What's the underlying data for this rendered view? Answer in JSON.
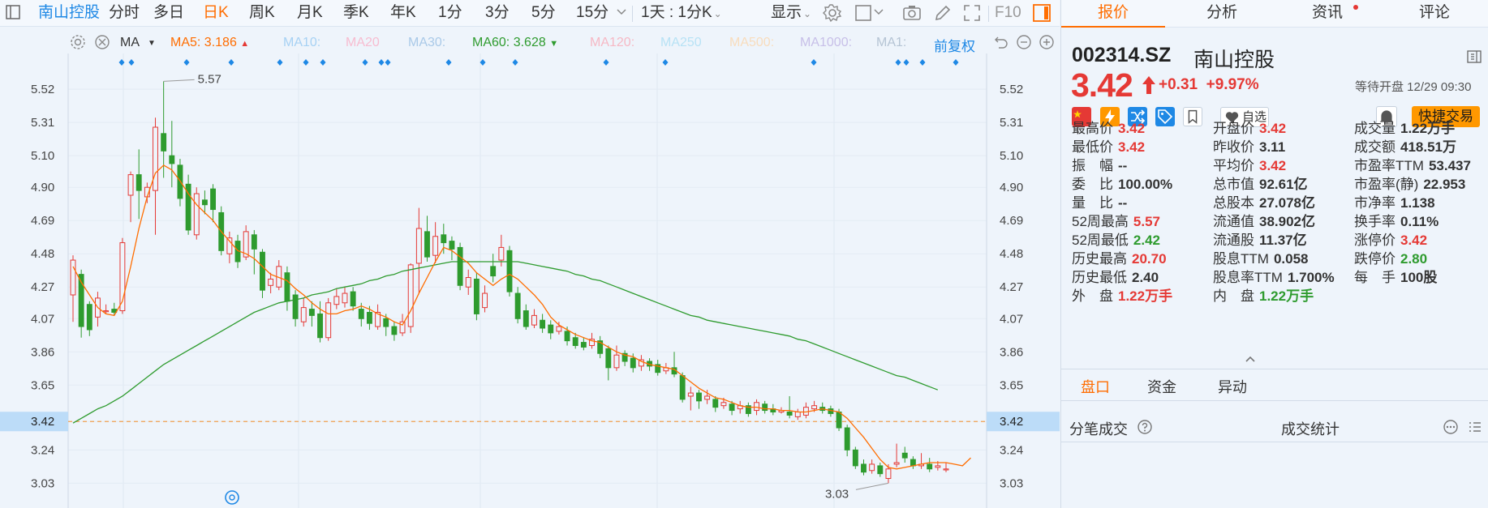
{
  "toolbar": {
    "stock_name": "南山控股",
    "periods": [
      "分时",
      "多日",
      "日K",
      "周K",
      "月K",
      "季K",
      "年K",
      "1分",
      "3分",
      "5分",
      "15分"
    ],
    "active_period": "日K",
    "multi_period": "1天 : 1分K",
    "display_label": "显示",
    "f10_label": "F10"
  },
  "ma_bar": {
    "label": "MA",
    "items": [
      {
        "label": "MA5:",
        "value": "3.186",
        "color": "#ff6d00",
        "trend": "up"
      },
      {
        "label": "MA10:",
        "value": "",
        "color": "#a6d1f4"
      },
      {
        "label": "MA20",
        "value": "",
        "color": "#f7bcd0"
      },
      {
        "label": "MA30:",
        "value": "",
        "color": "#a9c9e8"
      },
      {
        "label": "MA60:",
        "value": "3.628",
        "color": "#2e9b2e",
        "trend": "down"
      },
      {
        "label": "MA120:",
        "value": "",
        "color": "#f6b8c4"
      },
      {
        "label": "MA250",
        "value": "",
        "color": "#b7e2f5"
      },
      {
        "label": "MA500:",
        "value": "",
        "color": "#f8dcbc"
      },
      {
        "label": "MA1000:",
        "value": "",
        "color": "#c7bfe8"
      },
      {
        "label": "MA1:",
        "value": "",
        "color": "#b5c4d4"
      }
    ],
    "restore_label": "前复权"
  },
  "chart_data": {
    "type": "candlestick",
    "y_ticks": [
      "5.52",
      "5.31",
      "5.10",
      "4.90",
      "4.69",
      "4.48",
      "4.27",
      "4.07",
      "3.86",
      "3.65",
      "3.42",
      "3.24",
      "3.03"
    ],
    "current_price_label": "3.42",
    "high_annotation": "5.57",
    "low_annotation": "3.03",
    "ylim": [
      2.95,
      5.65
    ],
    "candles": [
      {
        "o": 4.22,
        "c": 4.44,
        "h": 4.47,
        "l": 4.05
      },
      {
        "o": 4.35,
        "c": 4.02,
        "h": 4.38,
        "l": 3.95
      },
      {
        "o": 4.16,
        "c": 4.0,
        "h": 4.18,
        "l": 3.96
      },
      {
        "o": 4.08,
        "c": 4.2,
        "h": 4.24,
        "l": 4.02
      },
      {
        "o": 4.12,
        "c": 4.12,
        "h": 4.16,
        "l": 4.1
      },
      {
        "o": 4.13,
        "c": 4.11,
        "h": 4.17,
        "l": 4.09
      },
      {
        "o": 4.12,
        "c": 4.55,
        "h": 4.58,
        "l": 4.1
      },
      {
        "o": 4.85,
        "c": 4.98,
        "h": 5.0,
        "l": 4.68
      },
      {
        "o": 4.98,
        "c": 4.88,
        "h": 5.14,
        "l": 4.7
      },
      {
        "o": 4.84,
        "c": 4.9,
        "h": 4.93,
        "l": 4.8
      },
      {
        "o": 4.88,
        "c": 5.28,
        "h": 5.34,
        "l": 4.6
      },
      {
        "o": 5.24,
        "c": 5.13,
        "h": 5.57,
        "l": 4.96
      },
      {
        "o": 5.1,
        "c": 5.05,
        "h": 5.32,
        "l": 4.9
      },
      {
        "o": 5.04,
        "c": 4.83,
        "h": 5.08,
        "l": 4.78
      },
      {
        "o": 4.92,
        "c": 4.63,
        "h": 4.98,
        "l": 4.6
      },
      {
        "o": 4.6,
        "c": 4.86,
        "h": 4.9,
        "l": 4.57
      },
      {
        "o": 4.82,
        "c": 4.79,
        "h": 4.88,
        "l": 4.73
      },
      {
        "o": 4.89,
        "c": 4.76,
        "h": 4.92,
        "l": 4.68
      },
      {
        "o": 4.74,
        "c": 4.5,
        "h": 4.78,
        "l": 4.47
      },
      {
        "o": 4.48,
        "c": 4.58,
        "h": 4.62,
        "l": 4.42
      },
      {
        "o": 4.56,
        "c": 4.43,
        "h": 4.6,
        "l": 4.39
      },
      {
        "o": 4.46,
        "c": 4.62,
        "h": 4.66,
        "l": 4.44
      },
      {
        "o": 4.6,
        "c": 4.51,
        "h": 4.63,
        "l": 4.35
      },
      {
        "o": 4.49,
        "c": 4.25,
        "h": 4.51,
        "l": 4.2
      },
      {
        "o": 4.28,
        "c": 4.32,
        "h": 4.36,
        "l": 4.23
      },
      {
        "o": 4.27,
        "c": 4.4,
        "h": 4.44,
        "l": 4.25
      },
      {
        "o": 4.36,
        "c": 4.18,
        "h": 4.4,
        "l": 4.12
      },
      {
        "o": 4.22,
        "c": 4.07,
        "h": 4.25,
        "l": 4.02
      },
      {
        "o": 4.05,
        "c": 4.14,
        "h": 4.2,
        "l": 4.02
      },
      {
        "o": 4.13,
        "c": 4.09,
        "h": 4.18,
        "l": 4.02
      },
      {
        "o": 4.1,
        "c": 3.95,
        "h": 4.18,
        "l": 3.92
      },
      {
        "o": 3.95,
        "c": 4.17,
        "h": 4.2,
        "l": 3.93
      },
      {
        "o": 4.16,
        "c": 4.21,
        "h": 4.26,
        "l": 4.13
      },
      {
        "o": 4.17,
        "c": 4.23,
        "h": 4.27,
        "l": 4.14
      },
      {
        "o": 4.24,
        "c": 4.15,
        "h": 4.27,
        "l": 4.12
      },
      {
        "o": 4.13,
        "c": 4.07,
        "h": 4.17,
        "l": 4.02
      },
      {
        "o": 4.11,
        "c": 4.04,
        "h": 4.15,
        "l": 4.0
      },
      {
        "o": 4.02,
        "c": 4.11,
        "h": 4.16,
        "l": 4.0
      },
      {
        "o": 4.07,
        "c": 4.02,
        "h": 4.1,
        "l": 3.96
      },
      {
        "o": 4.02,
        "c": 3.97,
        "h": 4.05,
        "l": 3.93
      },
      {
        "o": 3.98,
        "c": 4.05,
        "h": 4.1,
        "l": 3.96
      },
      {
        "o": 4.02,
        "c": 4.41,
        "h": 4.42,
        "l": 3.98
      },
      {
        "o": 4.42,
        "c": 4.64,
        "h": 4.77,
        "l": 4.23
      },
      {
        "o": 4.62,
        "c": 4.46,
        "h": 4.72,
        "l": 4.43
      },
      {
        "o": 4.47,
        "c": 4.59,
        "h": 4.68,
        "l": 4.42
      },
      {
        "o": 4.6,
        "c": 4.55,
        "h": 4.67,
        "l": 4.48
      },
      {
        "o": 4.56,
        "c": 4.51,
        "h": 4.59,
        "l": 4.44
      },
      {
        "o": 4.52,
        "c": 4.28,
        "h": 4.55,
        "l": 4.25
      },
      {
        "o": 4.27,
        "c": 4.33,
        "h": 4.38,
        "l": 4.22
      },
      {
        "o": 4.32,
        "c": 4.1,
        "h": 4.36,
        "l": 4.06
      },
      {
        "o": 4.14,
        "c": 4.23,
        "h": 4.28,
        "l": 4.11
      },
      {
        "o": 4.4,
        "c": 4.34,
        "h": 4.48,
        "l": 4.3
      },
      {
        "o": 4.44,
        "c": 4.52,
        "h": 4.6,
        "l": 4.4
      },
      {
        "o": 4.5,
        "c": 4.24,
        "h": 4.53,
        "l": 4.21
      },
      {
        "o": 4.23,
        "c": 4.07,
        "h": 4.27,
        "l": 4.04
      },
      {
        "o": 4.12,
        "c": 4.02,
        "h": 4.16,
        "l": 4.0
      },
      {
        "o": 4.03,
        "c": 4.09,
        "h": 4.13,
        "l": 4.01
      },
      {
        "o": 4.06,
        "c": 4.01,
        "h": 4.1,
        "l": 3.98
      },
      {
        "o": 4.03,
        "c": 3.98,
        "h": 4.06,
        "l": 3.94
      },
      {
        "o": 3.99,
        "c": 4.02,
        "h": 4.05,
        "l": 3.97
      },
      {
        "o": 3.99,
        "c": 3.93,
        "h": 4.02,
        "l": 3.9
      },
      {
        "o": 3.95,
        "c": 3.9,
        "h": 3.98,
        "l": 3.88
      },
      {
        "o": 3.92,
        "c": 3.89,
        "h": 3.95,
        "l": 3.87
      },
      {
        "o": 3.9,
        "c": 3.94,
        "h": 3.98,
        "l": 3.88
      },
      {
        "o": 3.93,
        "c": 3.85,
        "h": 3.96,
        "l": 3.82
      },
      {
        "o": 3.88,
        "c": 3.76,
        "h": 3.9,
        "l": 3.68
      },
      {
        "o": 3.76,
        "c": 3.84,
        "h": 3.9,
        "l": 3.74
      },
      {
        "o": 3.85,
        "c": 3.8,
        "h": 3.87,
        "l": 3.77
      },
      {
        "o": 3.82,
        "c": 3.76,
        "h": 3.85,
        "l": 3.73
      },
      {
        "o": 3.77,
        "c": 3.81,
        "h": 3.84,
        "l": 3.74
      },
      {
        "o": 3.8,
        "c": 3.77,
        "h": 3.82,
        "l": 3.74
      },
      {
        "o": 3.78,
        "c": 3.73,
        "h": 3.81,
        "l": 3.71
      },
      {
        "o": 3.74,
        "c": 3.76,
        "h": 3.79,
        "l": 3.72
      },
      {
        "o": 3.76,
        "c": 3.72,
        "h": 3.86,
        "l": 3.7
      },
      {
        "o": 3.71,
        "c": 3.56,
        "h": 3.73,
        "l": 3.54
      },
      {
        "o": 3.58,
        "c": 3.6,
        "h": 3.64,
        "l": 3.49
      },
      {
        "o": 3.6,
        "c": 3.55,
        "h": 3.62,
        "l": 3.5
      },
      {
        "o": 3.56,
        "c": 3.58,
        "h": 3.62,
        "l": 3.53
      },
      {
        "o": 3.56,
        "c": 3.51,
        "h": 3.58,
        "l": 3.48
      },
      {
        "o": 3.52,
        "c": 3.54,
        "h": 3.57,
        "l": 3.5
      },
      {
        "o": 3.53,
        "c": 3.49,
        "h": 3.55,
        "l": 3.46
      },
      {
        "o": 3.5,
        "c": 3.52,
        "h": 3.55,
        "l": 3.47
      },
      {
        "o": 3.52,
        "c": 3.47,
        "h": 3.54,
        "l": 3.45
      },
      {
        "o": 3.49,
        "c": 3.54,
        "h": 3.56,
        "l": 3.46
      },
      {
        "o": 3.53,
        "c": 3.49,
        "h": 3.55,
        "l": 3.47
      },
      {
        "o": 3.5,
        "c": 3.48,
        "h": 3.53,
        "l": 3.46
      },
      {
        "o": 3.48,
        "c": 3.49,
        "h": 3.51,
        "l": 3.47
      },
      {
        "o": 3.48,
        "c": 3.46,
        "h": 3.58,
        "l": 3.44
      },
      {
        "o": 3.45,
        "c": 3.48,
        "h": 3.5,
        "l": 3.43
      },
      {
        "o": 3.46,
        "c": 3.51,
        "h": 3.54,
        "l": 3.44
      },
      {
        "o": 3.5,
        "c": 3.52,
        "h": 3.55,
        "l": 3.48
      },
      {
        "o": 3.51,
        "c": 3.49,
        "h": 3.54,
        "l": 3.47
      },
      {
        "o": 3.5,
        "c": 3.47,
        "h": 3.52,
        "l": 3.45
      },
      {
        "o": 3.48,
        "c": 3.38,
        "h": 3.5,
        "l": 3.36
      },
      {
        "o": 3.38,
        "c": 3.24,
        "h": 3.4,
        "l": 3.2
      },
      {
        "o": 3.24,
        "c": 3.14,
        "h": 3.26,
        "l": 3.12
      },
      {
        "o": 3.15,
        "c": 3.1,
        "h": 3.18,
        "l": 3.08
      },
      {
        "o": 3.11,
        "c": 3.15,
        "h": 3.18,
        "l": 3.09
      },
      {
        "o": 3.14,
        "c": 3.09,
        "h": 3.16,
        "l": 3.07
      },
      {
        "o": 3.06,
        "c": 3.12,
        "h": 3.15,
        "l": 3.03
      },
      {
        "o": 3.15,
        "c": 3.16,
        "h": 3.28,
        "l": 3.13
      },
      {
        "o": 3.22,
        "c": 3.19,
        "h": 3.26,
        "l": 3.16
      },
      {
        "o": 3.18,
        "c": 3.14,
        "h": 3.2,
        "l": 3.12
      },
      {
        "o": 3.14,
        "c": 3.15,
        "h": 3.22,
        "l": 3.12
      },
      {
        "o": 3.15,
        "c": 3.12,
        "h": 3.19,
        "l": 3.1
      },
      {
        "o": 3.13,
        "c": 3.14,
        "h": 3.17,
        "l": 3.11
      },
      {
        "o": 3.12,
        "c": 3.12,
        "h": 3.16,
        "l": 3.1
      }
    ],
    "ma5": [
      4.4,
      4.3,
      4.22,
      4.14,
      4.1,
      4.09,
      4.18,
      4.4,
      4.64,
      4.84,
      4.99,
      5.04,
      5.01,
      4.94,
      4.86,
      4.79,
      4.74,
      4.69,
      4.62,
      4.56,
      4.5,
      4.48,
      4.45,
      4.4,
      4.35,
      4.33,
      4.31,
      4.26,
      4.22,
      4.17,
      4.13,
      4.1,
      4.1,
      4.12,
      4.13,
      4.15,
      4.13,
      4.1,
      4.08,
      4.05,
      4.03,
      4.12,
      4.23,
      4.33,
      4.43,
      4.52,
      4.5,
      4.46,
      4.42,
      4.36,
      4.32,
      4.28,
      4.32,
      4.35,
      4.32,
      4.27,
      4.22,
      4.16,
      4.08,
      4.03,
      4.0,
      3.97,
      3.95,
      3.93,
      3.92,
      3.89,
      3.86,
      3.84,
      3.83,
      3.8,
      3.78,
      3.77,
      3.76,
      3.75,
      3.71,
      3.67,
      3.63,
      3.6,
      3.57,
      3.56,
      3.54,
      3.52,
      3.51,
      3.51,
      3.5,
      3.5,
      3.49,
      3.49,
      3.48,
      3.48,
      3.49,
      3.5,
      3.49,
      3.48,
      3.44,
      3.38,
      3.32,
      3.25,
      3.18,
      3.13,
      3.12,
      3.13,
      3.14,
      3.15,
      3.16,
      3.16,
      3.16,
      3.15,
      3.14,
      3.19
    ],
    "ma60": [
      3.41,
      3.44,
      3.47,
      3.5,
      3.52,
      3.55,
      3.58,
      3.62,
      3.66,
      3.7,
      3.74,
      3.78,
      3.81,
      3.84,
      3.87,
      3.9,
      3.93,
      3.96,
      3.99,
      4.02,
      4.05,
      4.08,
      4.11,
      4.13,
      4.15,
      4.17,
      4.18,
      4.19,
      4.2,
      4.22,
      4.23,
      4.24,
      4.26,
      4.27,
      4.28,
      4.29,
      4.31,
      4.32,
      4.34,
      4.35,
      4.37,
      4.38,
      4.39,
      4.4,
      4.41,
      4.42,
      4.43,
      4.43,
      4.43,
      4.43,
      4.43,
      4.43,
      4.43,
      4.43,
      4.43,
      4.42,
      4.41,
      4.4,
      4.39,
      4.38,
      4.37,
      4.35,
      4.34,
      4.32,
      4.31,
      4.29,
      4.27,
      4.25,
      4.23,
      4.21,
      4.19,
      4.17,
      4.15,
      4.13,
      4.11,
      4.09,
      4.08,
      4.06,
      4.05,
      4.04,
      4.03,
      4.02,
      4.01,
      4.0,
      3.99,
      3.98,
      3.97,
      3.96,
      3.94,
      3.93,
      3.91,
      3.89,
      3.87,
      3.85,
      3.83,
      3.81,
      3.79,
      3.77,
      3.75,
      3.73,
      3.71,
      3.7,
      3.68,
      3.66,
      3.64,
      3.62
    ]
  },
  "quote": {
    "tabs": [
      {
        "label": "报价"
      },
      {
        "label": "分析"
      },
      {
        "label": "资讯"
      },
      {
        "label": "评论"
      }
    ],
    "code": "002314.SZ",
    "name": "南山控股",
    "price": "3.42",
    "change": "+0.31",
    "change_pct": "+9.97%",
    "status": "等待开盘 12/29 09:30",
    "fav_label": "自选",
    "trade_label": "快捷交易",
    "stats": [
      [
        {
          "label": "最高价",
          "value": "3.42",
          "color": "red"
        },
        {
          "label": "开盘价",
          "value": "3.42",
          "color": "red"
        },
        {
          "label": "成交量",
          "value": "1.22万手",
          "color": "dark"
        }
      ],
      [
        {
          "label": "最低价",
          "value": "3.42",
          "color": "red"
        },
        {
          "label": "昨收价",
          "value": "3.11",
          "color": "dark"
        },
        {
          "label": "成交额",
          "value": "418.51万",
          "color": "dark"
        }
      ],
      [
        {
          "label": "振　幅",
          "value": "--",
          "color": "dark"
        },
        {
          "label": "平均价",
          "value": "3.42",
          "color": "red"
        },
        {
          "label": "市盈率TTM",
          "value": "53.437",
          "color": "dark"
        }
      ],
      [
        {
          "label": "委　比",
          "value": "100.00%",
          "color": "dark"
        },
        {
          "label": "总市值",
          "value": "92.61亿",
          "color": "dark"
        },
        {
          "label": "市盈率(静)",
          "value": "22.953",
          "color": "dark"
        }
      ],
      [
        {
          "label": "量　比",
          "value": "--",
          "color": "dark"
        },
        {
          "label": "总股本",
          "value": "27.078亿",
          "color": "dark"
        },
        {
          "label": "市净率",
          "value": "1.138",
          "color": "dark"
        }
      ],
      [
        {
          "label": "52周最高",
          "value": "5.57",
          "color": "red"
        },
        {
          "label": "流通值",
          "value": "38.902亿",
          "color": "dark"
        },
        {
          "label": "换手率",
          "value": "0.11%",
          "color": "dark"
        }
      ],
      [
        {
          "label": "52周最低",
          "value": "2.42",
          "color": "green"
        },
        {
          "label": "流通股",
          "value": "11.37亿",
          "color": "dark"
        },
        {
          "label": "涨停价",
          "value": "3.42",
          "color": "red"
        }
      ],
      [
        {
          "label": "历史最高",
          "value": "20.70",
          "color": "red"
        },
        {
          "label": "股息TTM",
          "value": "0.058",
          "color": "dark"
        },
        {
          "label": "跌停价",
          "value": "2.80",
          "color": "green"
        }
      ],
      [
        {
          "label": "历史最低",
          "value": "2.40",
          "color": "dark"
        },
        {
          "label": "股息率TTM",
          "value": "1.700%",
          "color": "dark"
        },
        {
          "label": "每　手",
          "value": "100股",
          "color": "dark"
        }
      ],
      [
        {
          "label": "外　盘",
          "value": "1.22万手",
          "color": "red"
        },
        {
          "label": "内　盘",
          "value": "1.22万手",
          "color": "green"
        }
      ]
    ],
    "sub_tabs": [
      {
        "label": "盘口"
      },
      {
        "label": "资金"
      },
      {
        "label": "异动"
      }
    ],
    "tick_title": "分笔成交",
    "stat_title": "成交统计"
  },
  "colors": {
    "up": "#e53935",
    "down": "#2e9b2e",
    "ma5": "#ff6d00",
    "ma60": "#2e9b2e",
    "accent": "#1e88e5",
    "orange": "#ff6d00"
  }
}
